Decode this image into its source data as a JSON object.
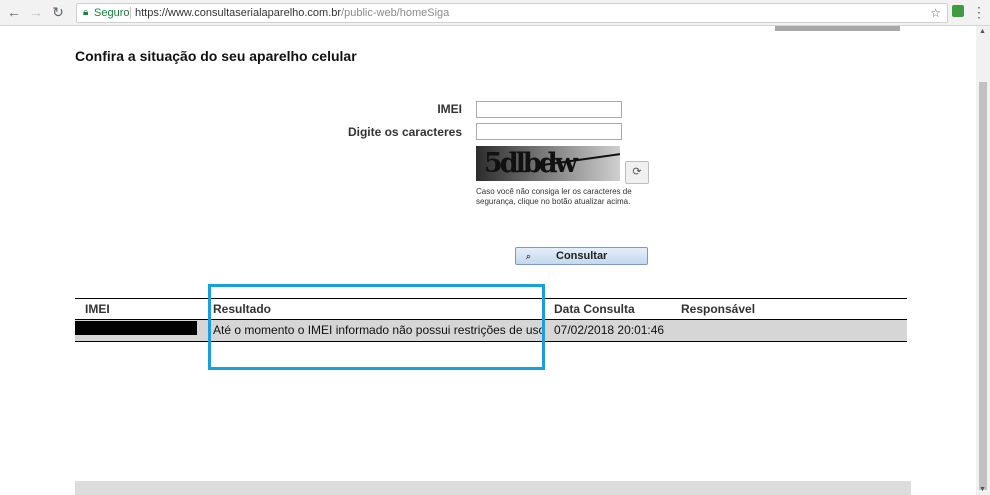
{
  "browser": {
    "secure_label": "Seguro",
    "url_host": "https://www.consultaserialaparelho.com.br",
    "url_path": "/public-web/homeSiga"
  },
  "page": {
    "title": "Confira a situação do seu aparelho celular"
  },
  "form": {
    "imei_label": "IMEI",
    "imei_value": "",
    "chars_label": "Digite os caracteres",
    "chars_value": "",
    "captcha_text": "5dlbdw",
    "hint": "Caso você não consiga ler os caracteres de segurança, clique no botão atualizar acima.",
    "submit_label": "Consultar"
  },
  "results": {
    "columns": [
      "IMEI",
      "Resultado",
      "Data Consulta",
      "Responsável"
    ],
    "rows": [
      {
        "imei": "",
        "resultado": "Até o momento o IMEI informado não possui restrições de uso",
        "data_consulta": "07/02/2018 20:01:46",
        "responsavel": ""
      }
    ]
  },
  "colors": {
    "highlight": "#1a9fdb",
    "row_background": "#d6d6d6"
  },
  "icons": [
    "back-arrow-icon",
    "forward-arrow-icon",
    "reload-icon",
    "lock-icon",
    "star-icon",
    "extension-icon",
    "menu-icon",
    "refresh-icon",
    "search-icon"
  ]
}
